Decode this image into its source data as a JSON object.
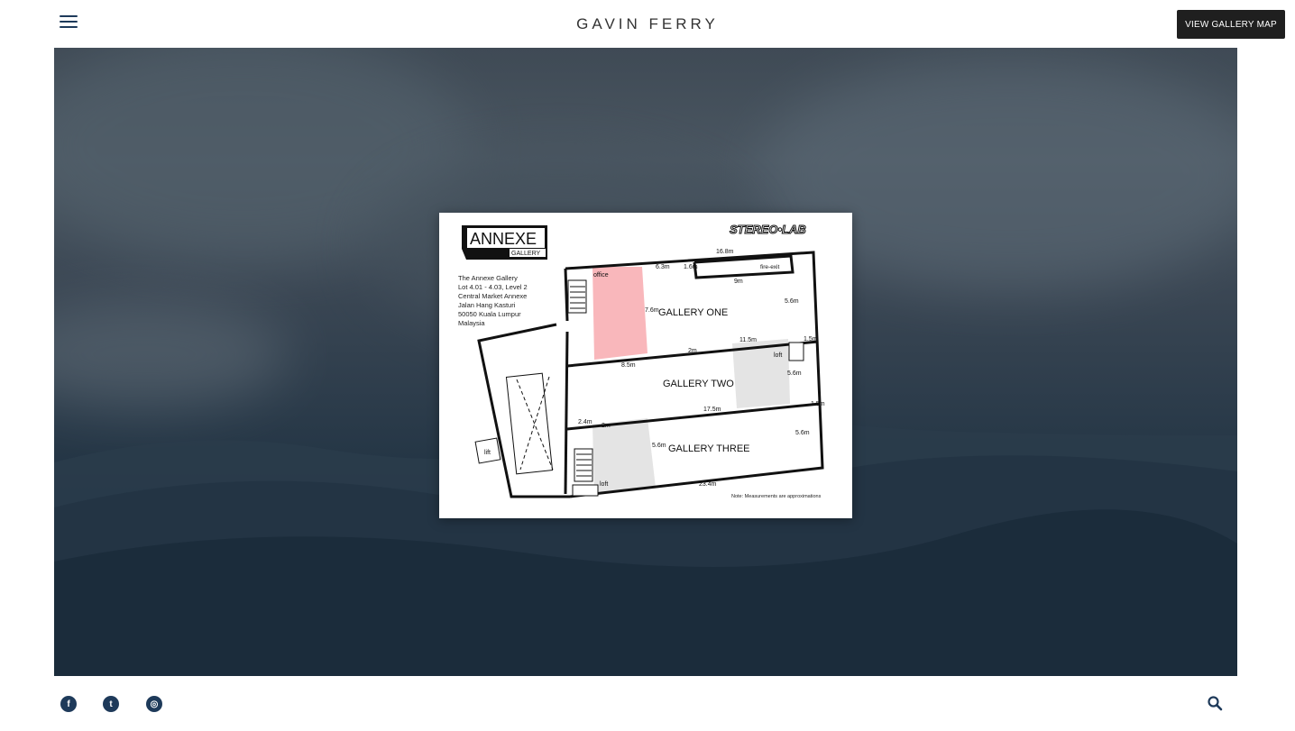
{
  "header": {
    "title": "GAVIN FERRY",
    "menu_icon": "hamburger-menu-icon",
    "map_button_label": "VIEW GALLERY MAP"
  },
  "map": {
    "logo_main": "ANNEXE",
    "logo_sub": "GALLERY",
    "brand": "STEREO•LAB",
    "address": [
      "The Annexe Gallery",
      "Lot 4.01 - 4.03, Level 2",
      "Central Market Annexe",
      "Jalan Hang Kasturi",
      "50050 Kuala Lumpur",
      "Malaysia"
    ],
    "rooms": {
      "gallery_one": "GALLERY ONE",
      "gallery_two": "GALLERY TWO",
      "gallery_three": "GALLERY THREE",
      "office": "office",
      "fire_exit": "fire-exit",
      "loft_1": "loft",
      "loft_2": "loft",
      "lift": "lift"
    },
    "dimensions": {
      "top_width": "16.8m",
      "d_6_3": "6.3m",
      "d_1_6": "1.6m",
      "d_9": "9m",
      "d_5_6_a": "5.6m",
      "d_7_6": "7.6m",
      "d_11_5": "11.5m",
      "d_1_5_a": "1.5m",
      "d_2_a": "2m",
      "d_8_5": "8.5m",
      "d_5_6_b": "5.6m",
      "d_17_5": "17.5m",
      "d_1_5_b": "1.5m",
      "d_2_4": "2.4m",
      "d_2_b": "2m",
      "d_5_6_c": "5.6m",
      "d_5_6_d": "5.6m",
      "bottom_width": "23.4m"
    },
    "note": "Note: Measurements are approximations"
  },
  "footer": {
    "social": [
      {
        "name": "facebook-icon",
        "glyph": "f"
      },
      {
        "name": "twitter-icon",
        "glyph": "t"
      },
      {
        "name": "dribbble-icon",
        "glyph": "◎"
      }
    ],
    "search_icon": "search-icon"
  }
}
